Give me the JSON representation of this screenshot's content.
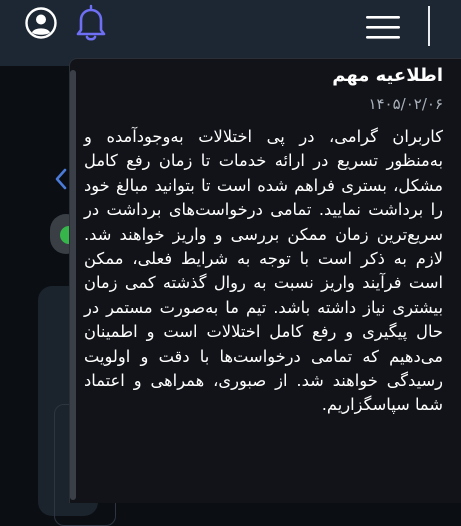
{
  "header": {
    "user_icon": "user-circle-icon",
    "bell_icon": "bell-icon",
    "menu_icon": "hamburger-menu-icon"
  },
  "colors": {
    "header_bg": "#1d2733",
    "popover_bg": "#111318",
    "bell_accent": "#6f6ff5",
    "status_green": "#36b54a"
  },
  "notification": {
    "title": "اطلاعیه مهم",
    "date": "۱۴۰۵/۰۲/۰۶",
    "body": "کاربران گرامی، در پی اختلالات به‌وجودآمده و به‌منظور تسریع در ارائه خدمات تا زمان رفع کامل مشکل، بستری فراهم شده است تا بتوانید مبالغ خود را برداشت نمایید. تمامی درخواست‌های برداشت در سریع‌ترین زمان ممکن بررسی و واریز خواهند شد. لازم به ذکر است با توجه به شرایط فعلی، ممکن است فرآیند واریز نسبت به روال گذشته کمی زمان بیشتری نیاز داشته باشد. تیم ما به‌صورت مستمر در حال پیگیری و رفع کامل اختلالات است و اطمینان می‌دهیم که تمامی درخواست‌ها با دقت و اولویت رسیدگی خواهند شد. از صبوری، همراهی و اعتماد شما سپاسگزاریم."
  }
}
